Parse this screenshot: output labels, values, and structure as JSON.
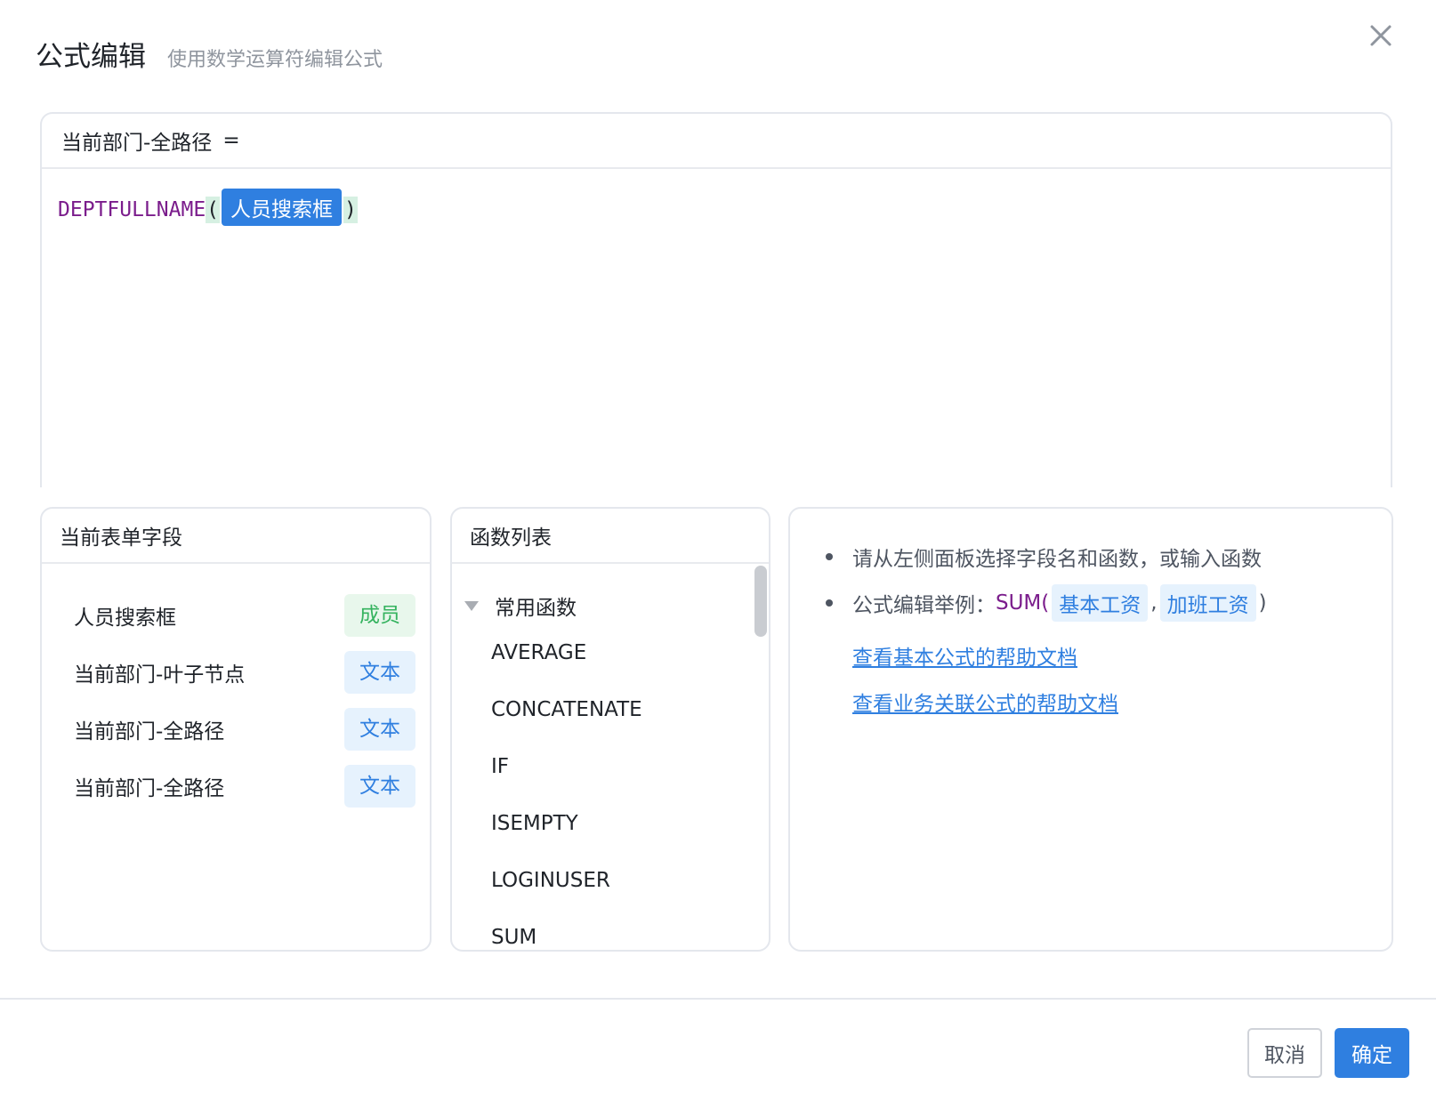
{
  "dialog": {
    "title": "公式编辑",
    "subtitle": "使用数学运算符编辑公式"
  },
  "editor": {
    "target_field": "当前部门-全路径",
    "equals": "=",
    "function_name": "DEPTFULLNAME",
    "open_paren": "(",
    "argument_token": "人员搜索框",
    "close_paren": ")"
  },
  "fields_panel": {
    "title": "当前表单字段",
    "items": [
      {
        "label": "人员搜索框",
        "type": "成员"
      },
      {
        "label": "当前部门-叶子节点",
        "type": "文本"
      },
      {
        "label": "当前部门-全路径",
        "type": "文本"
      },
      {
        "label": "当前部门-全路径",
        "type": "文本"
      }
    ]
  },
  "functions_panel": {
    "title": "函数列表",
    "group_label": "常用函数",
    "items": [
      "AVERAGE",
      "CONCATENATE",
      "IF",
      "ISEMPTY",
      "LOGINUSER",
      "SUM"
    ]
  },
  "help_panel": {
    "hint": "请从左侧面板选择字段名和函数，或输入函数",
    "example_label": "公式编辑举例：",
    "example_func": "SUM(",
    "example_arg1": "基本工资",
    "example_comma": ",",
    "example_arg2": "加班工资",
    "example_close": ")",
    "link_basic": "查看基本公式的帮助文档",
    "link_business": "查看业务关联公式的帮助文档"
  },
  "footer": {
    "cancel_label": "取消",
    "ok_label": "确定"
  },
  "colors": {
    "accent": "#2f7fe0",
    "function_purple": "#7b1d8c",
    "member_green": "#35b35f"
  }
}
